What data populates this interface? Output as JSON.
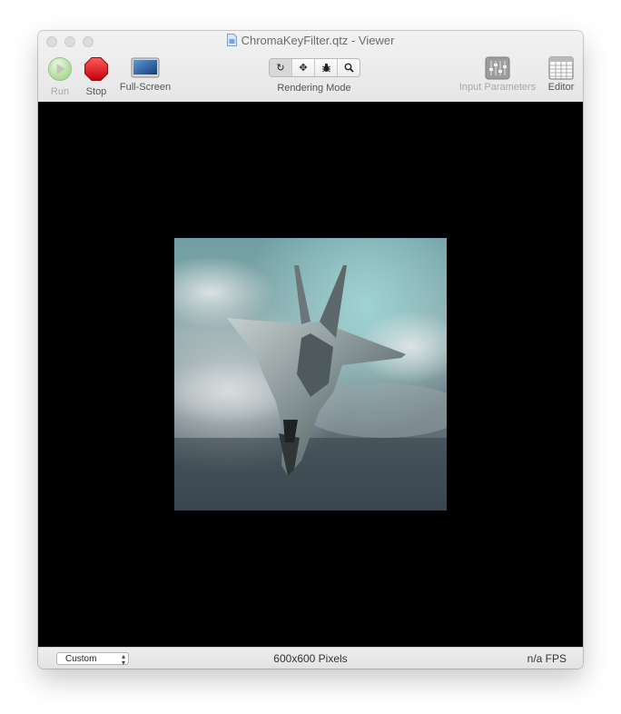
{
  "window": {
    "title": "ChromaKeyFilter.qtz - Viewer"
  },
  "toolbar": {
    "run_label": "Run",
    "stop_label": "Stop",
    "fullscreen_label": "Full-Screen",
    "rendering_mode_label": "Rendering Mode",
    "input_parameters_label": "Input Parameters",
    "editor_label": "Editor",
    "rendering_modes": [
      {
        "icon": "rotate-icon",
        "glyph": "↻"
      },
      {
        "icon": "move-icon",
        "glyph": "✥"
      },
      {
        "icon": "bug-icon",
        "glyph": "🐞"
      },
      {
        "icon": "zoom-icon",
        "glyph": "🔍"
      }
    ]
  },
  "status": {
    "size_preset": "Custom",
    "dimensions": "600x600 Pixels",
    "fps": "n/a FPS"
  },
  "colors": {
    "stop_red": "#e0141c",
    "run_green": "#8fcf6a",
    "canvas": "#000000"
  }
}
